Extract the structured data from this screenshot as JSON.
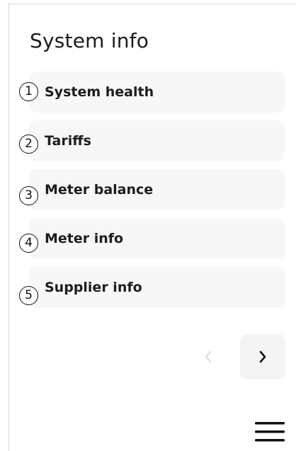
{
  "page": {
    "title": "System info"
  },
  "menu": {
    "items": [
      {
        "marker": "1",
        "label": "System health"
      },
      {
        "marker": "2",
        "label": "Tariffs"
      },
      {
        "marker": "3",
        "label": "Meter balance"
      },
      {
        "marker": "4",
        "label": "Meter info"
      },
      {
        "marker": "5",
        "label": "Supplier info"
      }
    ]
  },
  "pager": {
    "prev_icon": "chevron-left-icon",
    "next_icon": "chevron-right-icon",
    "prev_enabled": false,
    "next_enabled": true
  },
  "nav": {
    "menu_icon": "hamburger-menu-icon"
  },
  "colors": {
    "item_background": "#f7f7f7",
    "text": "#1d1d1d",
    "disabled_icon": "#dcdcdc",
    "active_icon": "#111111"
  }
}
